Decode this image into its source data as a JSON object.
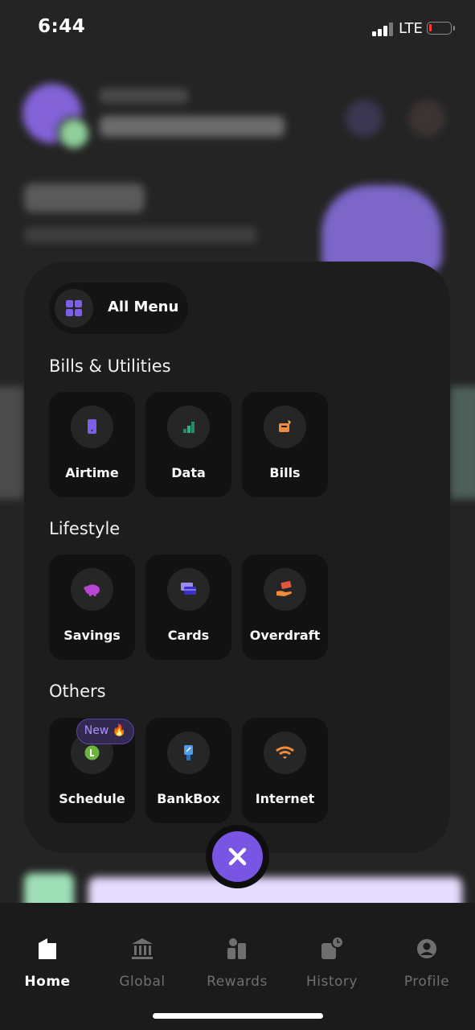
{
  "status_bar": {
    "time": "6:44",
    "network": "LTE"
  },
  "menu": {
    "title": "All Menu",
    "sections": [
      {
        "title": "Bills & Utilities",
        "items": [
          {
            "label": "Airtime",
            "icon": "phone-icon"
          },
          {
            "label": "Data",
            "icon": "signal-bars-icon"
          },
          {
            "label": "Bills",
            "icon": "receipt-icon"
          }
        ]
      },
      {
        "title": "Lifestyle",
        "items": [
          {
            "label": "Savings",
            "icon": "piggy-bank-icon"
          },
          {
            "label": "Cards",
            "icon": "card-icon"
          },
          {
            "label": "Overdraft",
            "icon": "cash-hand-icon"
          }
        ]
      },
      {
        "title": "Others",
        "items": [
          {
            "label": "Schedule",
            "icon": "clock-icon"
          },
          {
            "label": "BankBox",
            "icon": "pos-terminal-icon"
          },
          {
            "label": "Internet",
            "icon": "wifi-icon"
          }
        ]
      }
    ],
    "new_badge": "New 🔥"
  },
  "tabs": [
    {
      "label": "Home",
      "active": true
    },
    {
      "label": "Global",
      "active": false
    },
    {
      "label": "Rewards",
      "active": false
    },
    {
      "label": "History",
      "active": false
    },
    {
      "label": "Profile",
      "active": false
    }
  ],
  "colors": {
    "accent": "#7a55e3",
    "background": "#242424",
    "sheet": "#1d1d1d",
    "tile": "#121212"
  }
}
